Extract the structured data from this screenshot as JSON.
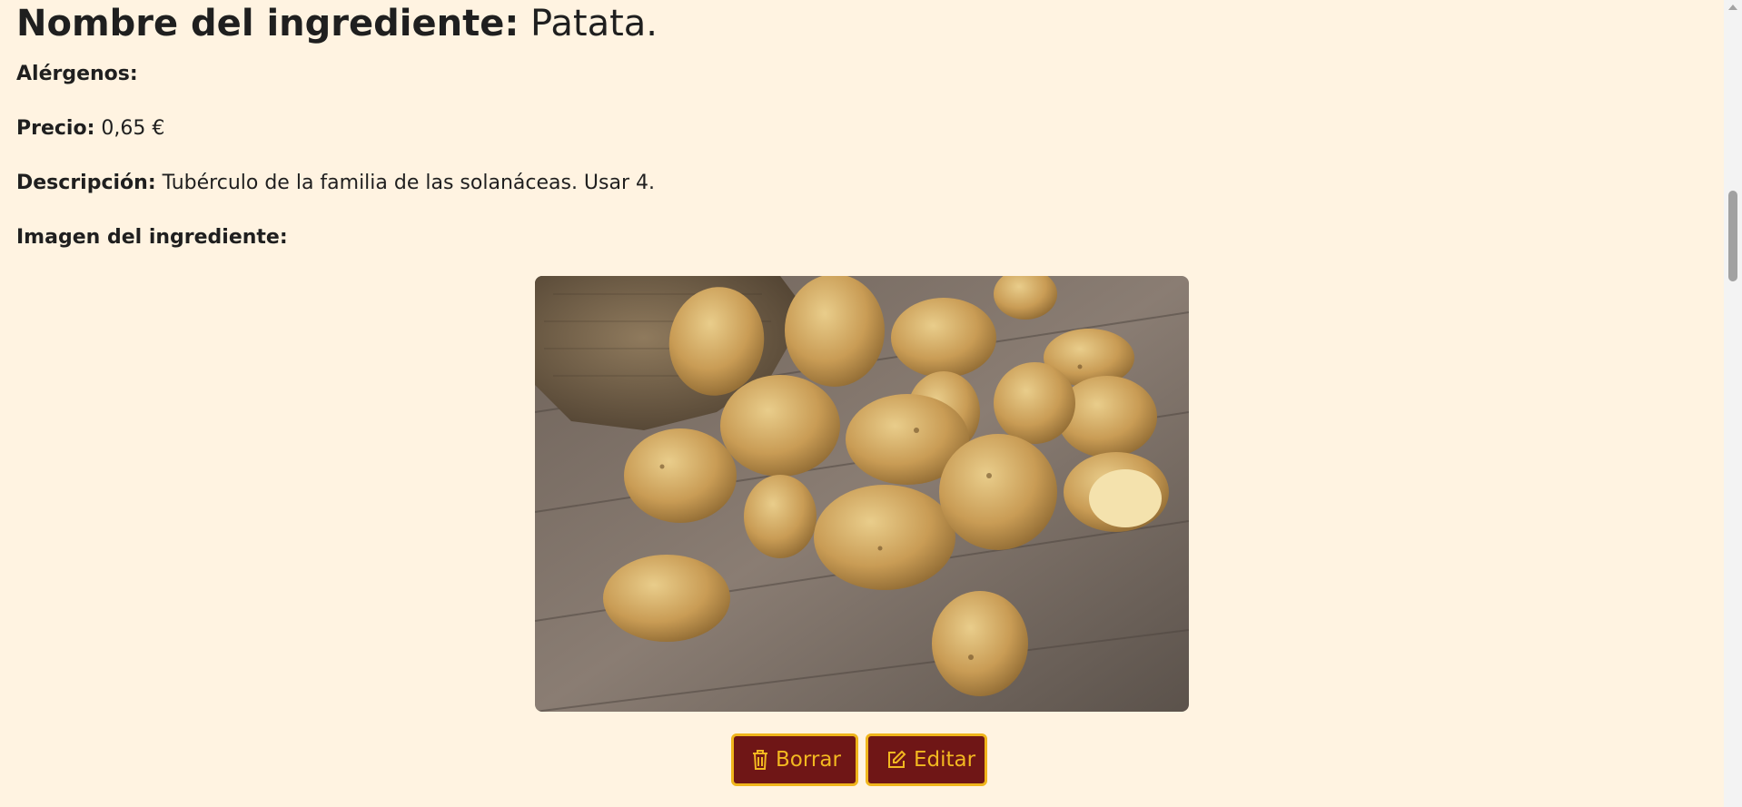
{
  "ingredient": {
    "name_label": "Nombre del ingrediente:",
    "name_value": "Patata.",
    "allergens_label": "Alérgenos:",
    "allergens_value": "",
    "price_label": "Precio:",
    "price_value": "0,65 €",
    "description_label": "Descripción:",
    "description_value": "Tubérculo de la familia de las solanáceas. Usar 4.",
    "image_label": "Imagen del ingrediente:"
  },
  "actions": {
    "delete_label": "Borrar",
    "edit_label": "Editar",
    "delete_icon": "trash-icon",
    "edit_icon": "edit-icon"
  },
  "colors": {
    "page_background": "#fff3e1",
    "button_background": "#6f1616",
    "button_accent": "#f0b51c"
  }
}
